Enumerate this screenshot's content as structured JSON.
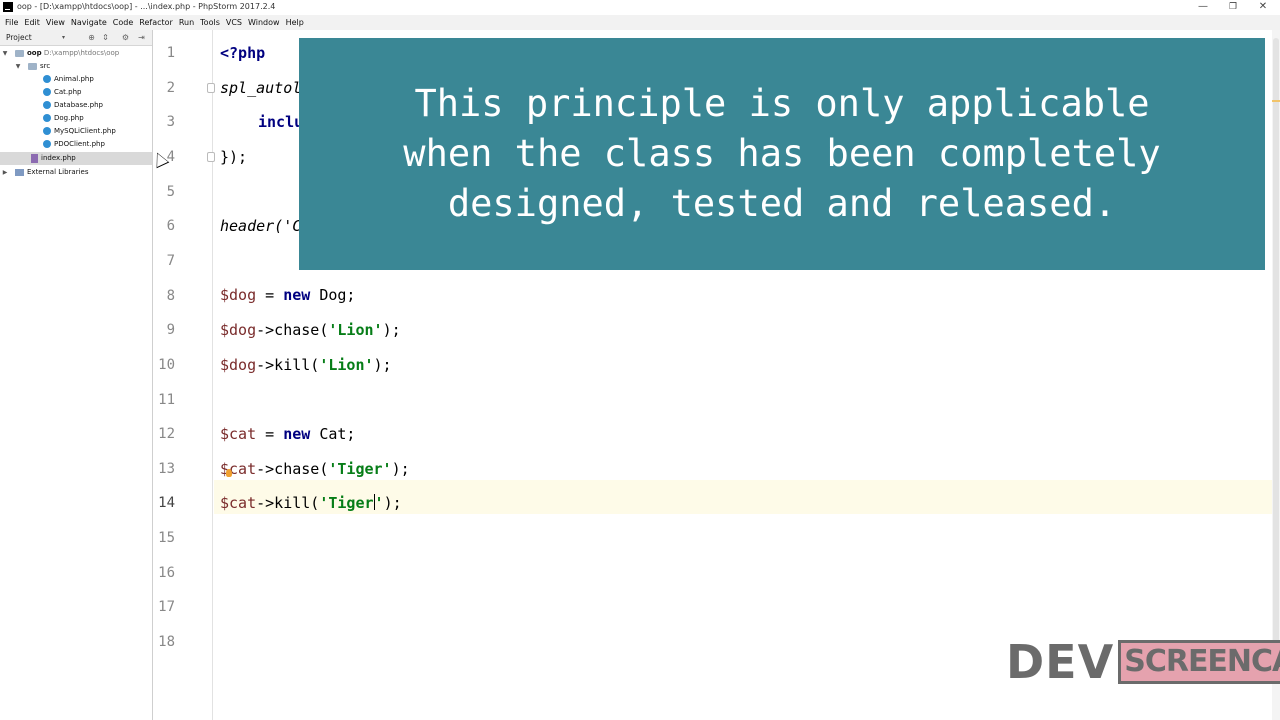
{
  "window": {
    "title": "oop - [D:\\xampp\\htdocs\\oop] - ...\\index.php - PhpStorm 2017.2.4",
    "minimize_glyph": "—",
    "maximize_glyph": "❐",
    "close_glyph": "✕"
  },
  "menu": {
    "items": [
      "File",
      "Edit",
      "View",
      "Navigate",
      "Code",
      "Refactor",
      "Run",
      "Tools",
      "VCS",
      "Window",
      "Help"
    ]
  },
  "project_panel": {
    "title": "Project",
    "caret": "▾",
    "tool_icons": [
      "locate-icon",
      "collapse-icon",
      "gear-icon",
      "hide-icon"
    ],
    "tree": {
      "root": {
        "name": "oop",
        "path": "D:\\xampp\\htdocs\\oop"
      },
      "src": {
        "name": "src"
      },
      "files": [
        "Animal.php",
        "Cat.php",
        "Database.php",
        "Dog.php",
        "MySQLiClient.php",
        "PDOClient.php"
      ],
      "selected_file": "index.php",
      "external": "External Libraries"
    }
  },
  "editor": {
    "line_numbers": [
      "1",
      "2",
      "3",
      "4",
      "5",
      "6",
      "7",
      "8",
      "9",
      "10",
      "11",
      "12",
      "13",
      "14",
      "15",
      "16",
      "17",
      "18"
    ],
    "current_line": "14",
    "code": {
      "l1": "<?php",
      "l2": "spl_autol",
      "l3": "inclu",
      "l4": "});",
      "l6": "header('C",
      "l8_var": "$dog",
      "l8_op": " = ",
      "l8_kw": "new",
      "l8_rest": " Dog;",
      "l9_var": "$dog",
      "l9_call": "->chase(",
      "l9_str": "'Lion'",
      "l9_end": ");",
      "l10_var": "$dog",
      "l10_call": "->kill(",
      "l10_str": "'Lion'",
      "l10_end": ");",
      "l12_var": "$cat",
      "l12_op": " = ",
      "l12_kw": "new",
      "l12_rest": " Cat;",
      "l13_var": "$cat",
      "l13_call": "->chase(",
      "l13_str": "'Tiger'",
      "l13_end": ");",
      "l14_var": "$cat",
      "l14_call": "->kill(",
      "l14_str_a": "'Tiger",
      "l14_str_b": "'",
      "l14_end": ");"
    }
  },
  "caption": {
    "line1": "This principle is only applicable",
    "line2": "when the class has been completely",
    "line3": "designed, tested and released."
  },
  "watermark": {
    "dev": "DEV",
    "screencast": "SCREENCAST"
  },
  "colors": {
    "caption_bg": "#3a8795",
    "variable": "#7a2c2c",
    "keyword": "#000080",
    "string": "#067d17",
    "current_line": "#fefbe8"
  }
}
